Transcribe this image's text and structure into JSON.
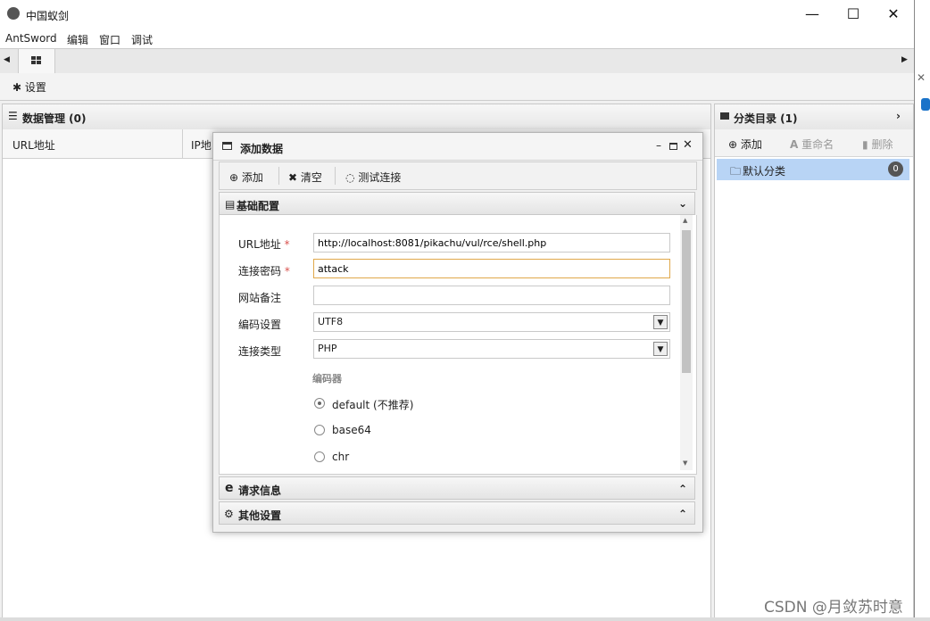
{
  "window": {
    "title": "中国蚁剑",
    "minimize": "—",
    "maximize": "☐",
    "close": "✕"
  },
  "menu": {
    "items": [
      "AntSword",
      "编辑",
      "窗口",
      "调试"
    ]
  },
  "toolbar": {
    "settings_label": "设置"
  },
  "data_panel": {
    "title": "数据管理 (0)",
    "columns": [
      "URL地址",
      "IP地"
    ]
  },
  "category_panel": {
    "title": "分类目录 (1)",
    "add_label": "添加",
    "rename_label": "重命名",
    "delete_label": "删除",
    "default_category": "默认分类",
    "default_count": "0"
  },
  "dialog": {
    "title": "添加数据",
    "toolbar": {
      "add": "添加",
      "clear": "清空",
      "test": "测试连接"
    },
    "basic_section": "基础配置",
    "fields": {
      "url_label": "URL地址",
      "url_value": "http://localhost:8081/pikachu/vul/rce/shell.php",
      "password_label": "连接密码",
      "password_value": "attack",
      "note_label": "网站备注",
      "note_value": "",
      "encoding_label": "编码设置",
      "encoding_value": "UTF8",
      "type_label": "连接类型",
      "type_value": "PHP"
    },
    "encoder_label": "编码器",
    "encoders": [
      {
        "label": "default (不推荐)",
        "selected": true
      },
      {
        "label": "base64",
        "selected": false
      },
      {
        "label": "chr",
        "selected": false
      }
    ],
    "request_section": "请求信息",
    "other_section": "其他设置"
  },
  "watermark": "CSDN @月敛苏时意",
  "colors": {
    "selected_row": "#b8d4f5",
    "required_star": "#d9534f",
    "focus_border": "#e0a84a"
  }
}
